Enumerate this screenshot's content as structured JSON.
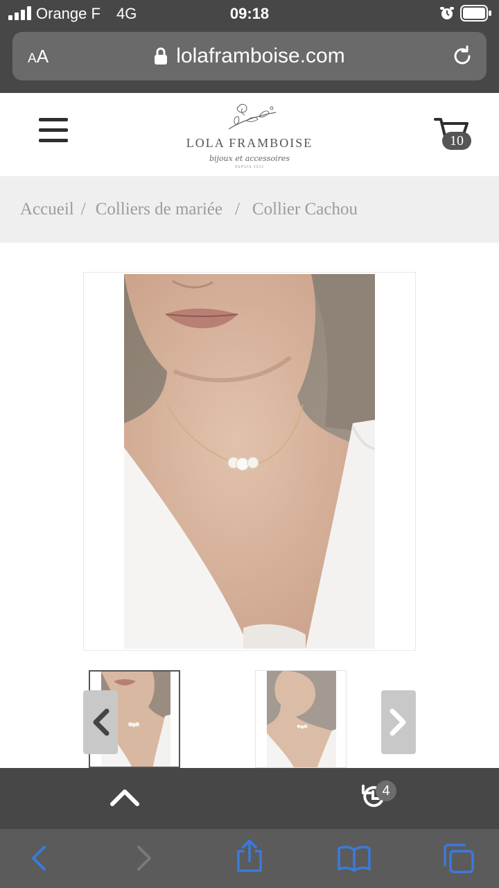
{
  "status_bar": {
    "carrier": "Orange F",
    "network": "4G",
    "time": "09:18"
  },
  "url_bar": {
    "text_size_label_small": "A",
    "text_size_label_large": "A",
    "domain": "lolaframboise.com"
  },
  "site_header": {
    "brand_name": "LOLA FRAMBOISE",
    "brand_tagline": "bijoux et accessoires",
    "brand_since": "DEPUIS 2012",
    "cart_count": "10"
  },
  "breadcrumb": {
    "items": [
      "Accueil",
      "Colliers de mariée",
      "Collier Cachou"
    ],
    "separator": "/"
  },
  "gallery": {
    "prev_icon": "chevron-left-icon",
    "next_icon": "chevron-right-icon"
  },
  "safari_toolbar": {
    "tabs_count": "4"
  },
  "colors": {
    "chrome_dark": "#474747",
    "accent_blue": "#3a7bdc",
    "breadcrumb_bg": "#efefef"
  }
}
